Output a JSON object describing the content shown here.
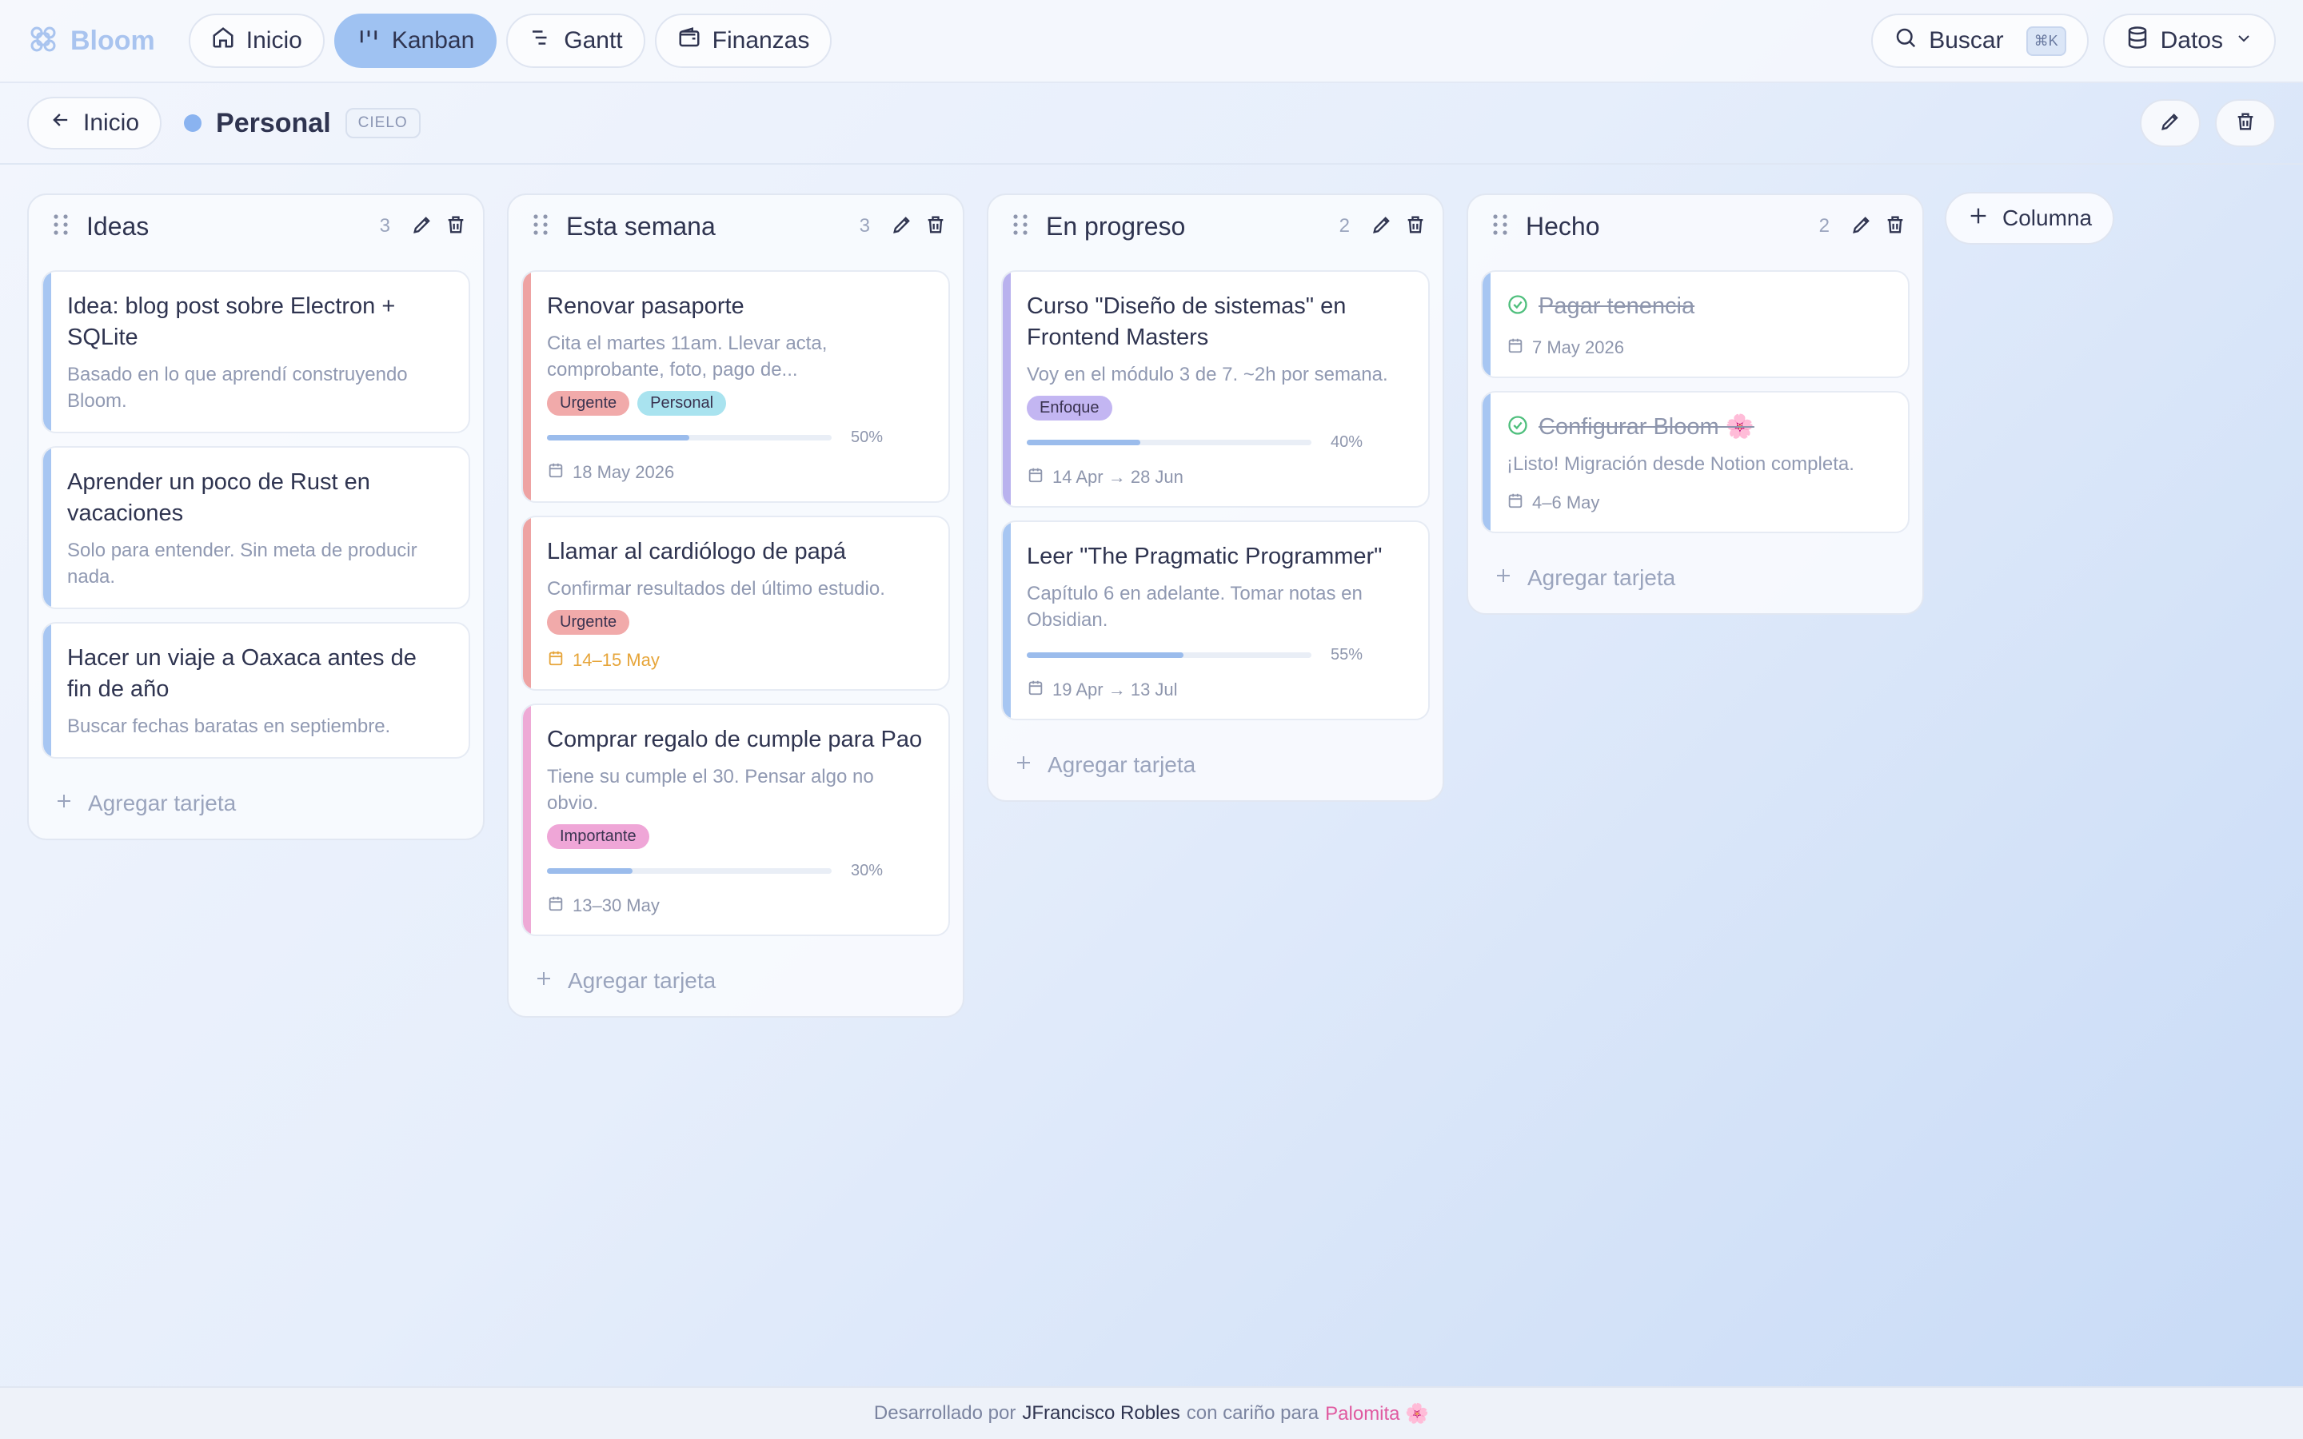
{
  "app": {
    "name": "Bloom"
  },
  "nav": [
    {
      "label": "Inicio",
      "icon": "home-icon",
      "active": false
    },
    {
      "label": "Kanban",
      "icon": "kanban-icon",
      "active": true
    },
    {
      "label": "Gantt",
      "icon": "gantt-icon",
      "active": false
    },
    {
      "label": "Finanzas",
      "icon": "wallet-icon",
      "active": false
    }
  ],
  "search": {
    "label": "Buscar",
    "shortcut": "⌘K"
  },
  "data_menu": {
    "label": "Datos"
  },
  "subheader": {
    "back_label": "Inicio",
    "board_name": "Personal",
    "board_theme": "CIELO",
    "board_color": "#8ab3f0"
  },
  "columns": [
    {
      "title": "Ideas",
      "count": "3",
      "add_label": "Agregar tarjeta",
      "cards": [
        {
          "title": "Idea: blog post sobre Electron + SQLite",
          "desc": "Basado en lo que aprendí construyendo Bloom.",
          "color": "#a7c6f2"
        },
        {
          "title": "Aprender un poco de Rust en vacaciones",
          "desc": "Solo para entender. Sin meta de producir nada.",
          "color": "#a7c6f2"
        },
        {
          "title": "Hacer un viaje a Oaxaca antes de fin de año",
          "desc": "Buscar fechas baratas en septiembre.",
          "color": "#a7c6f2"
        }
      ]
    },
    {
      "title": "Esta semana",
      "count": "3",
      "add_label": "Agregar tarjeta",
      "cards": [
        {
          "title": "Renovar pasaporte",
          "desc": "Cita el martes 11am. Llevar acta, comprobante, foto, pago de...",
          "color": "#eea3a3",
          "labels": [
            {
              "text": "Urgente",
              "bg": "#f1aaaa"
            },
            {
              "text": "Personal",
              "bg": "#a9e3ef"
            }
          ],
          "progress": 0.5,
          "progress_text": "50%",
          "date": "18 May 2026"
        },
        {
          "title": "Llamar al cardiólogo de papá",
          "desc": "Confirmar resultados del último estudio.",
          "color": "#eea3a3",
          "labels": [
            {
              "text": "Urgente",
              "bg": "#f1aaaa"
            }
          ],
          "date": "14–15 May",
          "date_warn": true
        },
        {
          "title": "Comprar regalo de cumple para Pao",
          "desc": "Tiene su cumple el 30. Pensar algo no obvio.",
          "color": "#eeaad6",
          "labels": [
            {
              "text": "Importante",
              "bg": "#efa6d7"
            }
          ],
          "progress": 0.3,
          "progress_text": "30%",
          "date": "13–30 May"
        }
      ]
    },
    {
      "title": "En progreso",
      "count": "2",
      "add_label": "Agregar tarjeta",
      "cards": [
        {
          "title": "Curso \"Diseño de sistemas\" en Frontend Masters",
          "desc": "Voy en el módulo 3 de 7. ~2h por semana.",
          "color": "#b9b2ee",
          "labels": [
            {
              "text": "Enfoque",
              "bg": "#c3b6f2"
            }
          ],
          "progress": 0.4,
          "progress_text": "40%",
          "date": "14 Apr → 28 Jun"
        },
        {
          "title": "Leer \"The Pragmatic Programmer\"",
          "desc": "Capítulo 6 en adelante. Tomar notas en Obsidian.",
          "color": "#a7c6f2",
          "progress": 0.55,
          "progress_text": "55%",
          "date": "19 Apr → 13 Jul"
        }
      ]
    },
    {
      "title": "Hecho",
      "count": "2",
      "add_label": "Agregar tarjeta",
      "cards": [
        {
          "title": "Pagar tenencia",
          "done": true,
          "color": "#a7c6f2",
          "date": "7 May 2026"
        },
        {
          "title": "Configurar Bloom 🌸",
          "done": true,
          "desc": "¡Listo! Migración desde Notion completa.",
          "color": "#a7c6f2",
          "date": "4–6 May"
        }
      ]
    }
  ],
  "add_column": {
    "label": "Columna"
  },
  "footer": {
    "prefix": "Desarrollado por",
    "author": "JFrancisco Robles",
    "middle": "con cariño para",
    "dedicatee": "Palomita 🌸"
  }
}
